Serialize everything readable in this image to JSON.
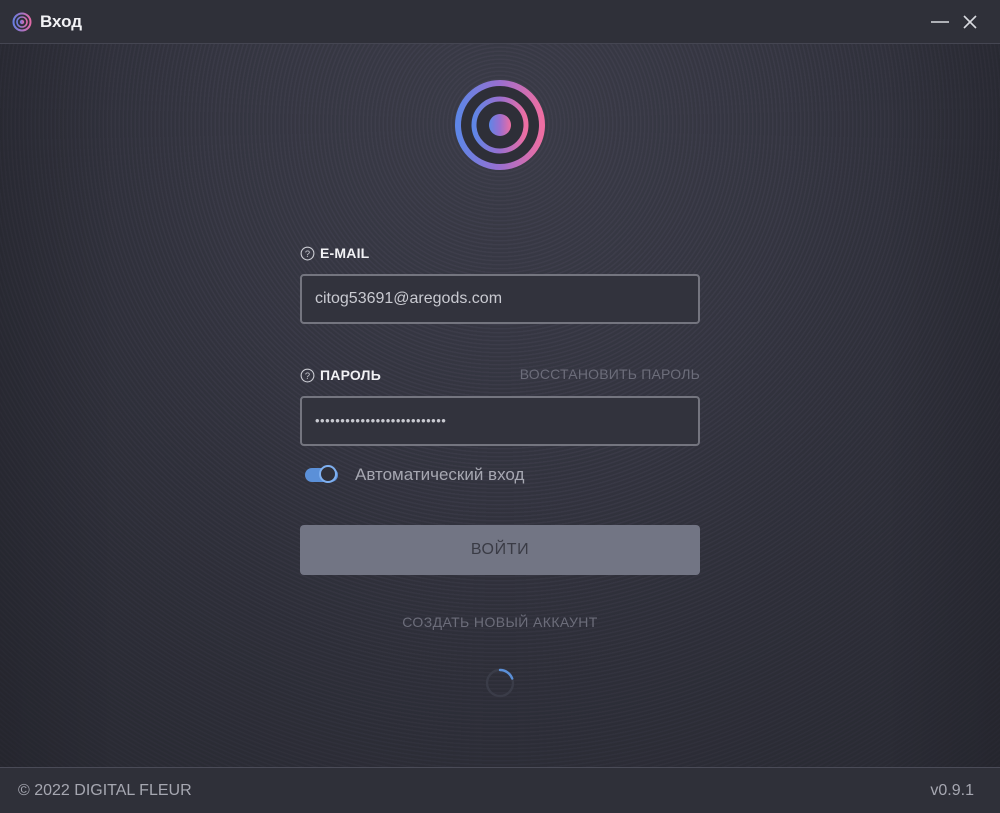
{
  "window": {
    "title": "Вход",
    "minimize_icon": "minimize-icon",
    "close_icon": "close-icon"
  },
  "form": {
    "email": {
      "label": "E-MAIL",
      "value": "citog53691@aregods.com",
      "help_icon": "question-circle-icon"
    },
    "password": {
      "label": "ПАРОЛЬ",
      "value": "••••••••••••••••••••••••••",
      "help_icon": "question-circle-icon",
      "restore_link": "ВОССТАНОВИТЬ ПАРОЛЬ"
    },
    "auto_login": {
      "label": "Автоматический вход",
      "enabled": true
    },
    "login_button": "ВОЙТИ",
    "create_account_link": "СОЗДАТЬ НОВЫЙ АККАУНТ"
  },
  "footer": {
    "copyright": "© 2022 DIGITAL FLEUR",
    "version": "v0.9.1"
  },
  "colors": {
    "background": "#2c2d36",
    "accent_blue": "#5b90d8",
    "accent_pink": "#e86aa6",
    "button": "#727584",
    "muted_text": "#6c6d7a"
  }
}
